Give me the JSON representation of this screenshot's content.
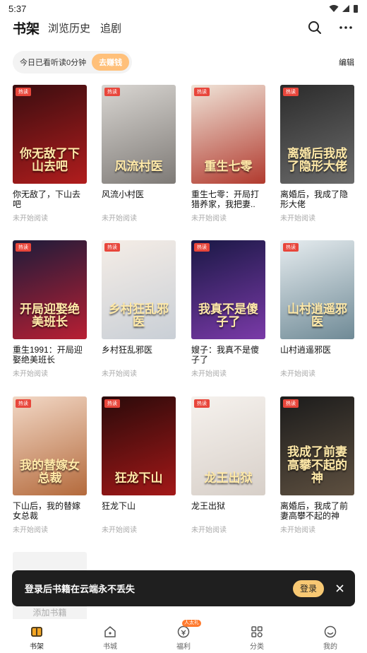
{
  "status_bar": {
    "time": "5:37"
  },
  "header": {
    "tabs": [
      {
        "label": "书架"
      },
      {
        "label": "浏览历史"
      },
      {
        "label": "追剧"
      }
    ]
  },
  "reading_bar": {
    "text": "今日已看听读0分钟",
    "earn_label": "去赚钱",
    "edit_label": "编辑"
  },
  "books": [
    {
      "title": "你无敌了，下山去吧",
      "cover_text": "你无敌了下山去吧",
      "status": "未开始阅读",
      "tag": "热读",
      "cover_colors": [
        "#3a0d10",
        "#b11d1d"
      ]
    },
    {
      "title": "风流小村医",
      "cover_text": "风流村医",
      "status": "未开始阅读",
      "tag": "热读",
      "cover_colors": [
        "#d9d6d2",
        "#7e7a76"
      ]
    },
    {
      "title": "重生七零：开局打猎养家，我把妻..",
      "cover_text": "重生七零",
      "status": "未开始阅读",
      "tag": "热读",
      "cover_colors": [
        "#f0e4d8",
        "#b13a2e"
      ]
    },
    {
      "title": "离婚后，我成了隐形大佬",
      "cover_text": "离婚后我成了隐形大佬",
      "status": "未开始阅读",
      "tag": "热读",
      "cover_colors": [
        "#2b2b2b",
        "#6b6b6b"
      ]
    },
    {
      "title": "重生1991：开局迎娶绝美班长",
      "cover_text": "开局迎娶绝美班长",
      "status": "未开始阅读",
      "tag": "热读",
      "cover_colors": [
        "#1d1b3a",
        "#b81f33"
      ]
    },
    {
      "title": "乡村狂乱邪医",
      "cover_text": "乡村狂乱邪医",
      "status": "未开始阅读",
      "tag": "热读",
      "cover_colors": [
        "#f5ede6",
        "#c9cfd6"
      ]
    },
    {
      "title": "嫂子：我真不是傻子了",
      "cover_text": "我真不是傻子了",
      "status": "未开始阅读",
      "tag": "热读",
      "cover_colors": [
        "#1a1845",
        "#7a3aa8"
      ]
    },
    {
      "title": "山村逍遥邪医",
      "cover_text": "山村逍遥邪医",
      "status": "未开始阅读",
      "tag": "热读",
      "cover_colors": [
        "#e6ecef",
        "#6f8a96"
      ]
    },
    {
      "title": "下山后，我的替嫁女总裁",
      "cover_text": "我的替嫁女总裁",
      "status": "未开始阅读",
      "tag": "热读",
      "cover_colors": [
        "#f2d8c6",
        "#b46a3c"
      ]
    },
    {
      "title": "狂龙下山",
      "cover_text": "狂龙下山",
      "status": "未开始阅读",
      "tag": "热读",
      "cover_colors": [
        "#2a0a0a",
        "#a31818"
      ]
    },
    {
      "title": "龙王出狱",
      "cover_text": "龙王出狱",
      "status": "未开始阅读",
      "tag": "热读",
      "cover_colors": [
        "#f6f2ee",
        "#d7cfc8"
      ]
    },
    {
      "title": "离婚后，我成了前妻高攀不起的神",
      "cover_text": "我成了前妻高攀不起的神",
      "status": "未开始阅读",
      "tag": "热读",
      "cover_colors": [
        "#1b1b1b",
        "#5e5040"
      ]
    }
  ],
  "add_book": {
    "label": "添加书籍"
  },
  "toast": {
    "text": "登录后书籍在云端永不丢失",
    "login_label": "登录"
  },
  "bottom_nav": {
    "items": [
      {
        "label": "书架",
        "icon": "bookshelf-icon",
        "active": true
      },
      {
        "label": "书城",
        "icon": "store-icon"
      },
      {
        "label": "福利",
        "icon": "gift-icon",
        "badge": "人太礼"
      },
      {
        "label": "分类",
        "icon": "category-icon"
      },
      {
        "label": "我的",
        "icon": "profile-icon"
      }
    ]
  },
  "colors": {
    "accent": "#ffc07a",
    "tag_red": "#e8463b",
    "toast_bg": "#1f1f1f",
    "login_btn": "#f7c873"
  }
}
